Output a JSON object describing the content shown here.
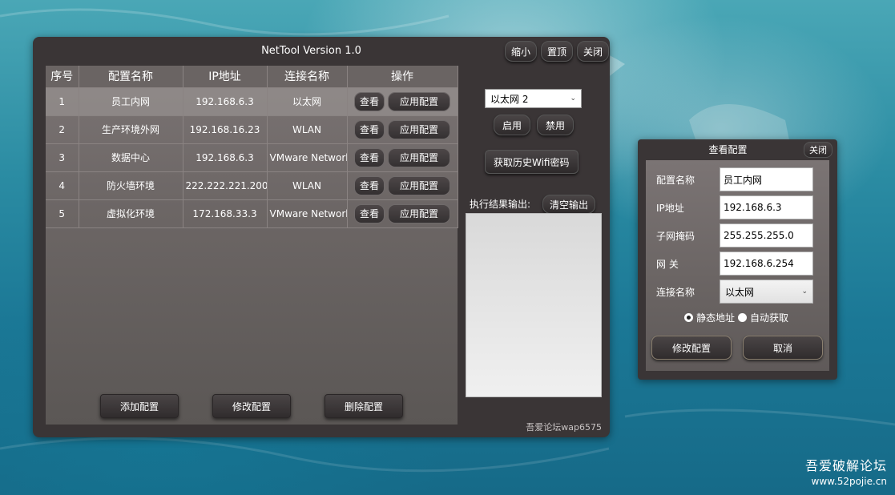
{
  "main_window": {
    "title": "NetTool Version 1.0",
    "controls": {
      "minimize": "缩小",
      "pin": "置顶",
      "close": "关闭"
    }
  },
  "table": {
    "headers": [
      "序号",
      "配置名称",
      "IP地址",
      "连接名称",
      "操作"
    ],
    "rows": [
      {
        "no": "1",
        "name": "员工内网",
        "ip": "192.168.6.3",
        "conn": "以太网",
        "selected": true
      },
      {
        "no": "2",
        "name": "生产环境外网",
        "ip": "192.168.16.23",
        "conn": "WLAN"
      },
      {
        "no": "3",
        "name": "数据中心",
        "ip": "192.168.6.3",
        "conn": "VMware Network"
      },
      {
        "no": "4",
        "name": "防火墙环境",
        "ip": "222.222.221.200",
        "conn": "WLAN"
      },
      {
        "no": "5",
        "name": "虚拟化环境",
        "ip": "172.168.33.3",
        "conn": "VMware Network"
      }
    ],
    "row_actions": {
      "view": "查看",
      "apply": "应用配置"
    }
  },
  "bottom_actions": {
    "add": "添加配置",
    "modify": "修改配置",
    "delete": "删除配置"
  },
  "side_panel": {
    "nic_selected": "以太网 2",
    "enable": "启用",
    "disable": "禁用",
    "wifi_history": "获取历史Wifi密码",
    "output_label": "执行结果输出:",
    "clear_output": "清空输出",
    "output_text": ""
  },
  "footer_credit": "吾爱论坛wap6575",
  "view_window": {
    "title": "查看配置",
    "close": "关闭",
    "fields": {
      "name_label": "配置名称",
      "name_value": "员工内网",
      "ip_label": "IP地址",
      "ip_value": "192.168.6.3",
      "mask_label": "子网掩码",
      "mask_value": "255.255.255.0",
      "gw_label": "网 关",
      "gw_value": "192.168.6.254",
      "conn_label": "连接名称",
      "conn_value": "以太网"
    },
    "mode": {
      "static": "静态地址",
      "dhcp": "自动获取",
      "selected": "static"
    },
    "modify": "修改配置",
    "cancel": "取消"
  },
  "watermark": {
    "title": "吾爱破解论坛",
    "url": "www.52pojie.cn"
  }
}
